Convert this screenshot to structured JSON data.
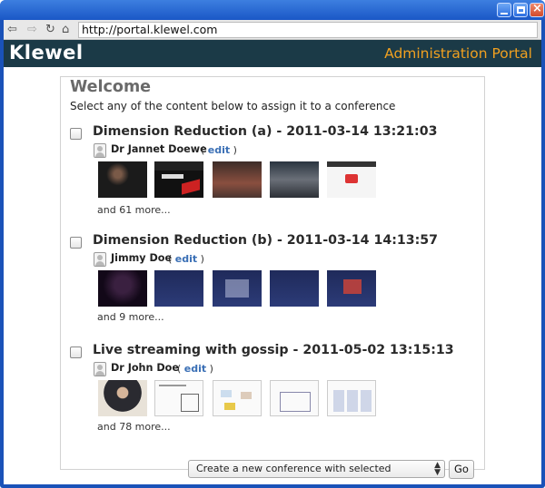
{
  "browser": {
    "url": "http://portal.klewel.com",
    "icons": {
      "back": "arrow-left-icon",
      "forward": "arrow-right-icon",
      "reload": "reload-icon",
      "home": "home-icon"
    }
  },
  "header": {
    "logo_text": "Klewel",
    "portal_title": "Administration Portal",
    "colors": {
      "header_bg": "#1b3a47",
      "title_accent": "#f0a020"
    }
  },
  "main": {
    "welcome": "Welcome",
    "subtitle": "Select any of the content below to assign it to a conference",
    "sessions": [
      {
        "title": "Dimension Reduction (a) - 2011-03-14 13:21:03",
        "speaker": "Dr Jannet Doewe",
        "edit_label": "edit",
        "more": "and 61 more..."
      },
      {
        "title": "Dimension Reduction (b) - 2011-03-14 14:13:57",
        "speaker": "Jimmy Doe",
        "edit_label": "edit",
        "more": "and 9 more..."
      },
      {
        "title": "Live streaming with gossip - 2011-05-02 13:15:13",
        "speaker": "Dr John Doe",
        "edit_label": "edit",
        "more": "and 78 more..."
      }
    ],
    "edit_open": "(",
    "edit_close": ")",
    "action_select": "Create a new conference with selected",
    "go_label": "Go"
  }
}
